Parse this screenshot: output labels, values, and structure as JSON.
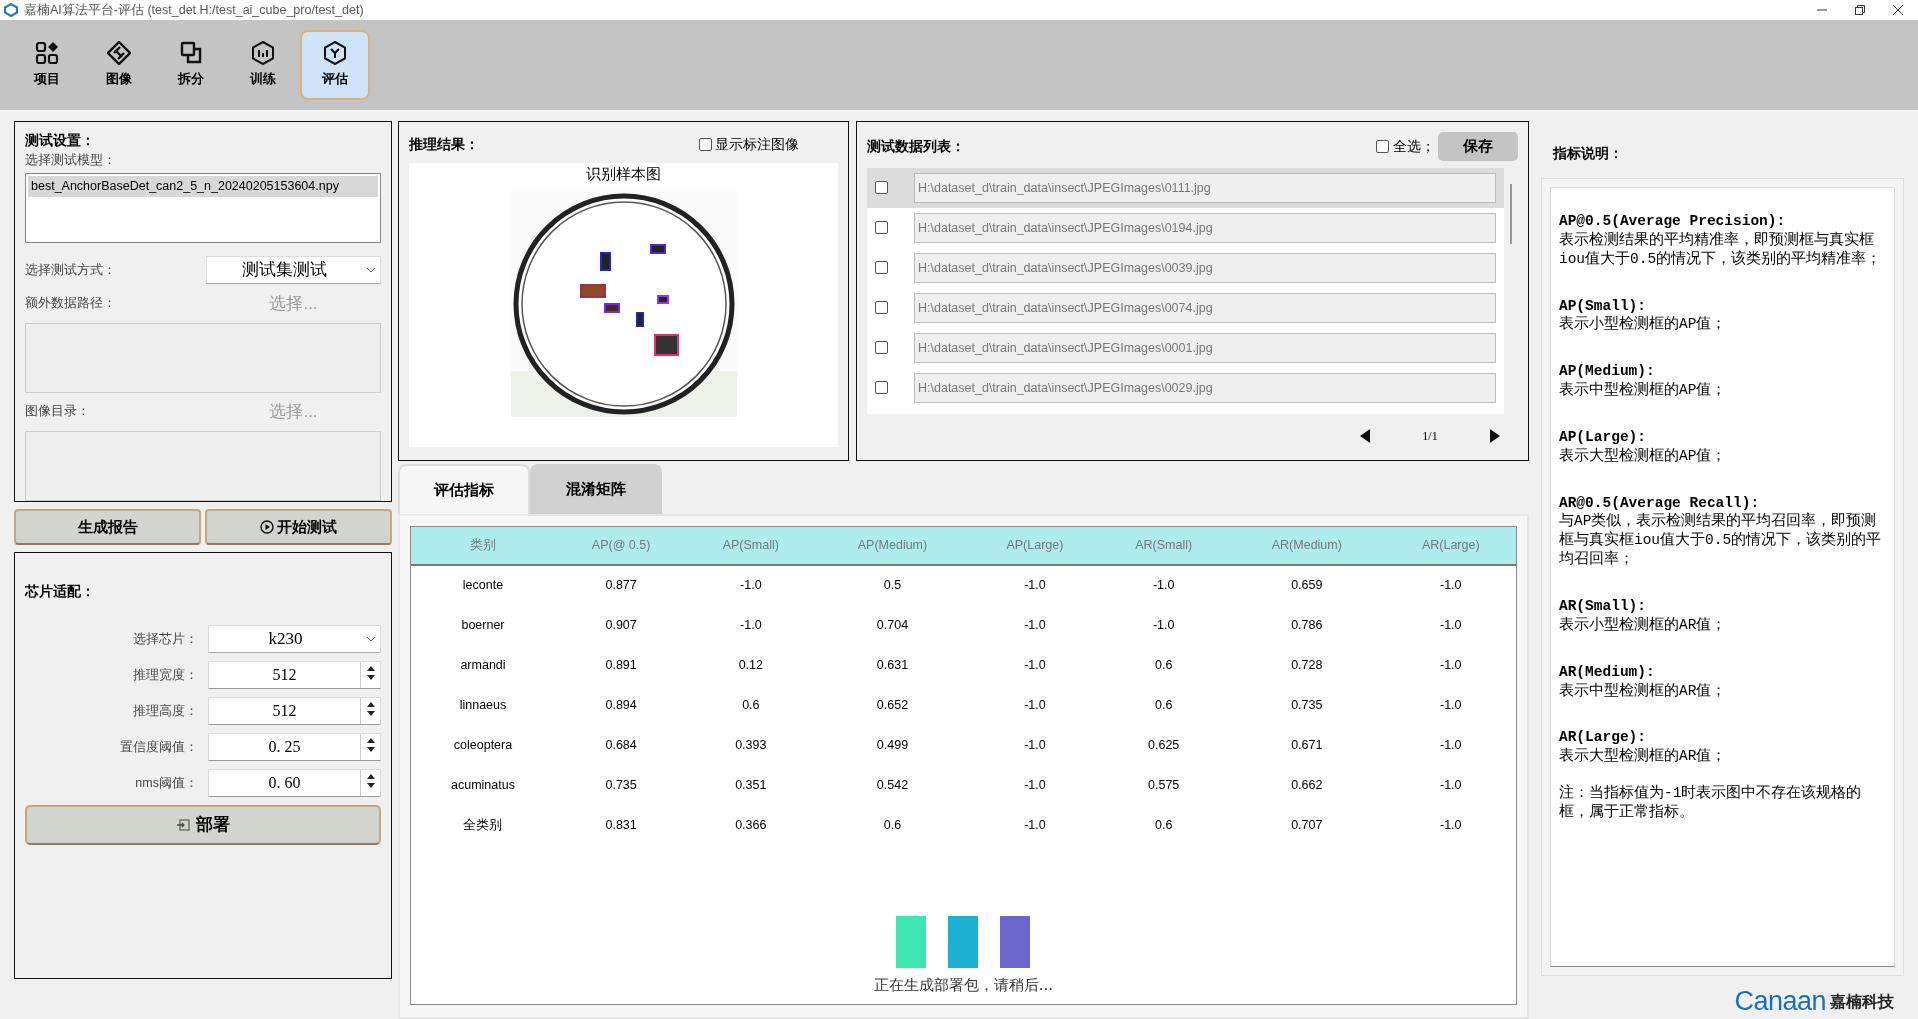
{
  "window": {
    "title": "嘉楠AI算法平台-评估 (test_det  H:/test_ai_cube_pro/test_det)"
  },
  "toolbar": [
    {
      "label": "项目",
      "kind": "grid",
      "selected": false
    },
    {
      "label": "图像",
      "kind": "diamond",
      "selected": false
    },
    {
      "label": "拆分",
      "kind": "layers",
      "selected": false
    },
    {
      "label": "训练",
      "kind": "hexagon",
      "selected": false
    },
    {
      "label": "评估",
      "kind": "cube",
      "selected": true
    }
  ],
  "test_settings": {
    "title": "测试设置：",
    "model_label": "选择测试模型：",
    "models": [
      {
        "name": "best_AnchorBaseDet_can2_5_n_20240205153604.npy",
        "selected": true
      }
    ],
    "mode_label": "选择测试方式：",
    "mode_value": "测试集测试",
    "extra_path_label": "额外数据路径：",
    "extra_path_button": "选择...",
    "image_dir_label": "图像目录：",
    "image_dir_button": "选择..."
  },
  "actions": [
    {
      "label": "生成报告",
      "kind": "plain"
    },
    {
      "label": "开始测试",
      "kind": "play"
    }
  ],
  "chip": {
    "title": "芯片适配：",
    "fields": [
      {
        "label": "选择芯片：",
        "kind": "select",
        "value": "k230"
      },
      {
        "label": "推理宽度：",
        "kind": "spin",
        "value": "512"
      },
      {
        "label": "推理高度：",
        "kind": "spin",
        "value": "512"
      },
      {
        "label": "置信度阈值：",
        "kind": "spin",
        "value": "0. 25"
      },
      {
        "label": "nms阈值：",
        "kind": "spin",
        "value": "0. 60"
      }
    ],
    "deploy_button": "部署"
  },
  "inference": {
    "title": "推理结果：",
    "show_annotations": {
      "label": "显示标注图像",
      "checked": false
    },
    "image_caption": "识别样本图"
  },
  "data_list": {
    "title": "测试数据列表：",
    "select_all": {
      "label": "全选；",
      "checked": false
    },
    "save_button": "保存",
    "items": [
      {
        "path": "H:\\dataset_d\\train_data\\insect\\JPEGImages\\0111.jpg",
        "checked": false,
        "selected": true
      },
      {
        "path": "H:\\dataset_d\\train_data\\insect\\JPEGImages\\0194.jpg",
        "checked": false,
        "selected": false
      },
      {
        "path": "H:\\dataset_d\\train_data\\insect\\JPEGImages\\0039.jpg",
        "checked": false,
        "selected": false
      },
      {
        "path": "H:\\dataset_d\\train_data\\insect\\JPEGImages\\0074.jpg",
        "checked": false,
        "selected": false
      },
      {
        "path": "H:\\dataset_d\\train_data\\insect\\JPEGImages\\0001.jpg",
        "checked": false,
        "selected": false
      },
      {
        "path": "H:\\dataset_d\\train_data\\insect\\JPEGImages\\0029.jpg",
        "checked": false,
        "selected": false
      }
    ],
    "page": "1/1"
  },
  "tabs": [
    {
      "label": "评估指标",
      "selected": true
    },
    {
      "label": "混淆矩阵",
      "selected": false
    }
  ],
  "table": {
    "columns": [
      "类别",
      "AP(@ 0.5)",
      "AP(Small)",
      "AP(Medium)",
      "AP(Large)",
      "AR(Small)",
      "AR(Medium)",
      "AR(Large)"
    ],
    "rows": [
      [
        "leconte",
        "0.877",
        "-1.0",
        "0.5",
        "-1.0",
        "-1.0",
        "0.659",
        "-1.0"
      ],
      [
        "boerner",
        "0.907",
        "-1.0",
        "0.704",
        "-1.0",
        "-1.0",
        "0.786",
        "-1.0"
      ],
      [
        "armandi",
        "0.891",
        "0.12",
        "0.631",
        "-1.0",
        "0.6",
        "0.728",
        "-1.0"
      ],
      [
        "linnaeus",
        "0.894",
        "0.6",
        "0.652",
        "-1.0",
        "0.6",
        "0.735",
        "-1.0"
      ],
      [
        "coleoptera",
        "0.684",
        "0.393",
        "0.499",
        "-1.0",
        "0.625",
        "0.671",
        "-1.0"
      ],
      [
        "acuminatus",
        "0.735",
        "0.351",
        "0.542",
        "-1.0",
        "0.575",
        "0.662",
        "-1.0"
      ],
      [
        "全类别",
        "0.831",
        "0.366",
        "0.6",
        "-1.0",
        "0.6",
        "0.707",
        "-1.0"
      ]
    ]
  },
  "loading": {
    "text": "正在生成部署包，请稍后...",
    "bars": [
      {
        "color": "#3ee6b0"
      },
      {
        "color": "#1db0d3"
      },
      {
        "color": "#6b66cc"
      }
    ]
  },
  "metrics_help": {
    "title": "指标说明：",
    "entries": [
      {
        "term": "AP@0.5(Average Precision):",
        "text": "表示检测结果的平均精准率，即预测框与真实框iou值大于0.5的情况下，该类别的平均精准率；"
      },
      {
        "term": "AP(Small):",
        "text": "表示小型检测框的AP值；"
      },
      {
        "term": "AP(Medium):",
        "text": "表示中型检测框的AP值；"
      },
      {
        "term": "AP(Large):",
        "text": "表示大型检测框的AP值；"
      },
      {
        "term": "AR@0.5(Average Recall):",
        "text": "与AP类似，表示检测结果的平均召回率，即预测框与真实框iou值大于0.5的情况下，该类别的平均召回率；"
      },
      {
        "term": "AR(Small):",
        "text": "表示小型检测框的AR值；"
      },
      {
        "term": "AR(Medium):",
        "text": "表示中型检测框的AR值；"
      },
      {
        "term": "AR(Large):",
        "text": "表示大型检测框的AR值；"
      }
    ],
    "note": "注：当指标值为-1时表示图中不存在该规格的框，属于正常指标。"
  },
  "brand": {
    "logo": "Canaan",
    "name": "嘉楠科技"
  }
}
